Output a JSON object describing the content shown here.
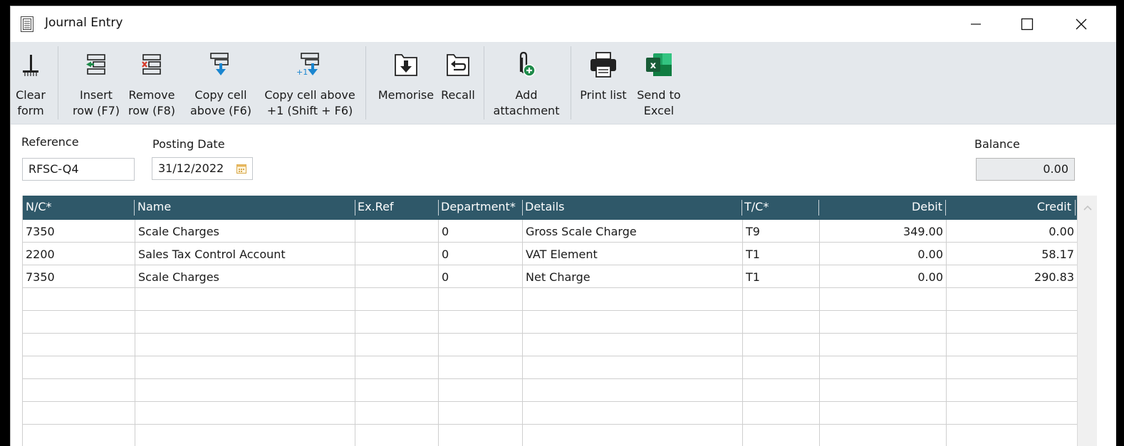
{
  "window": {
    "title": "Journal Entry"
  },
  "toolbar": {
    "clear_form": [
      "Clear",
      "form"
    ],
    "insert_row": [
      "Insert",
      "row (F7)"
    ],
    "remove_row": [
      "Remove",
      "row (F8)"
    ],
    "copy_cell_above": [
      "Copy cell",
      "above (F6)"
    ],
    "copy_cell_above_plus1": [
      "Copy cell above",
      "+1 (Shift + F6)"
    ],
    "memorise": "Memorise",
    "recall": "Recall",
    "add_attachment": [
      "Add",
      "attachment"
    ],
    "print_list": "Print list",
    "send_to_excel": [
      "Send to",
      "Excel"
    ],
    "copy_plus1_badge": "+1"
  },
  "form": {
    "reference_label": "Reference",
    "reference_value": "RFSC-Q4",
    "posting_date_label": "Posting Date",
    "posting_date_value": "31/12/2022",
    "balance_label": "Balance",
    "balance_value": "0.00"
  },
  "grid": {
    "columns": [
      "N/C*",
      "Name",
      "Ex.Ref",
      "Department*",
      "Details",
      "T/C*",
      "Debit",
      "Credit"
    ],
    "rows": [
      [
        "7350",
        "Scale Charges",
        "",
        "0",
        "Gross Scale Charge",
        "T9",
        "349.00",
        "0.00"
      ],
      [
        "2200",
        "Sales Tax Control Account",
        "",
        "0",
        "VAT Element",
        "T1",
        "0.00",
        "58.17"
      ],
      [
        "7350",
        "Scale Charges",
        "",
        "0",
        "Net Charge",
        "T1",
        "0.00",
        "290.83"
      ],
      [
        "",
        "",
        "",
        "",
        "",
        "",
        "",
        ""
      ],
      [
        "",
        "",
        "",
        "",
        "",
        "",
        "",
        ""
      ],
      [
        "",
        "",
        "",
        "",
        "",
        "",
        "",
        ""
      ],
      [
        "",
        "",
        "",
        "",
        "",
        "",
        "",
        ""
      ],
      [
        "",
        "",
        "",
        "",
        "",
        "",
        "",
        ""
      ],
      [
        "",
        "",
        "",
        "",
        "",
        "",
        "",
        ""
      ],
      [
        "",
        "",
        "",
        "",
        "",
        "",
        "",
        ""
      ]
    ]
  },
  "colors": {
    "header_bg": "#2f5869",
    "toolbar_bg": "#e4e8ec",
    "accent_blue": "#1a86d0",
    "excel_green": "#1e7a45"
  }
}
